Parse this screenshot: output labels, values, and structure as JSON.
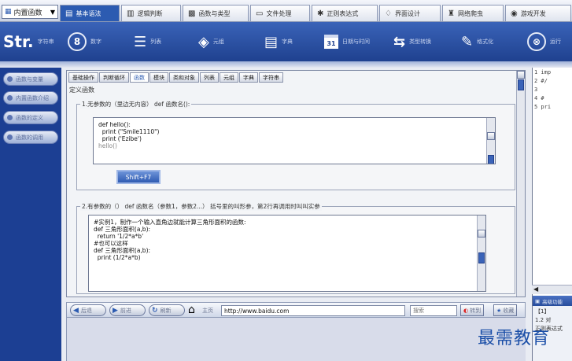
{
  "top_select": {
    "label": "内置函数"
  },
  "tabs": [
    {
      "label": "基本语法",
      "icon": "code-icon",
      "active": true
    },
    {
      "label": "逻辑判断",
      "icon": "bars-icon"
    },
    {
      "label": "函数与类型",
      "icon": "blocks-icon"
    },
    {
      "label": "文件处理",
      "icon": "file-icon"
    },
    {
      "label": "正则表达式",
      "icon": "star-icon"
    },
    {
      "label": "界面设计",
      "icon": "drop-icon"
    },
    {
      "label": "网络爬虫",
      "icon": "robot-icon"
    },
    {
      "label": "游戏开发",
      "icon": "gamepad-icon"
    }
  ],
  "toolbar": {
    "str_big": "Str.",
    "str_label": "字符串",
    "num_big": "8",
    "num_label": "数字",
    "list_label": "列表",
    "layer_label": "元组",
    "dict_label": "字典",
    "date_label": "日期与时间",
    "convert_label": "类型转换",
    "brush_label": "格式化",
    "clock_label": "运行"
  },
  "sidebar": {
    "items": [
      "函数与变量",
      "内置函数介绍",
      "函数的定义",
      "函数的调用"
    ]
  },
  "subtabs": [
    "基础操作",
    "判断循环",
    "函数",
    "模块",
    "类和对象",
    "列表",
    "元组",
    "字典",
    "字符串"
  ],
  "section_title": "定义函数",
  "group1": {
    "title": "1.无参数的（里边无内容）      def 函数名():",
    "code": [
      "def hello():",
      "  print (\"Smile1110\")",
      "  print ('Ezibe')",
      "",
      "hello()"
    ],
    "run_label": "Shift+F7"
  },
  "group2": {
    "title": "2.有参数的（）      def 函数名（参数1，参数2...）    括号里的叫形参，第2行再调用时叫叫实参",
    "code": [
      "#实例1，制作一个输入直角边就能计算三角形面积的函数:",
      "def 三角形面积(a,b):",
      "  return '1/2*a*b'",
      "",
      "#也可以这样",
      "def 三角形面积(a,b):",
      "  print (1/2*a*b)"
    ]
  },
  "right_pane": {
    "lines": [
      "1 imp",
      "2 #/",
      "3",
      "4 #",
      "5 pri"
    ]
  },
  "browser": {
    "back_label": "后退",
    "forward_label": "前进",
    "refresh_label": "刷新",
    "home_label": "主页",
    "url": "http://www.baidu.com",
    "search_placeholder": "搜索",
    "go_label": "转到",
    "fav_label": "收藏"
  },
  "right_bottom": {
    "bar_label": "高级功能",
    "lines": [
      "【1】",
      "1.2 对",
      "正则表达式"
    ]
  },
  "watermark": "最需教育"
}
